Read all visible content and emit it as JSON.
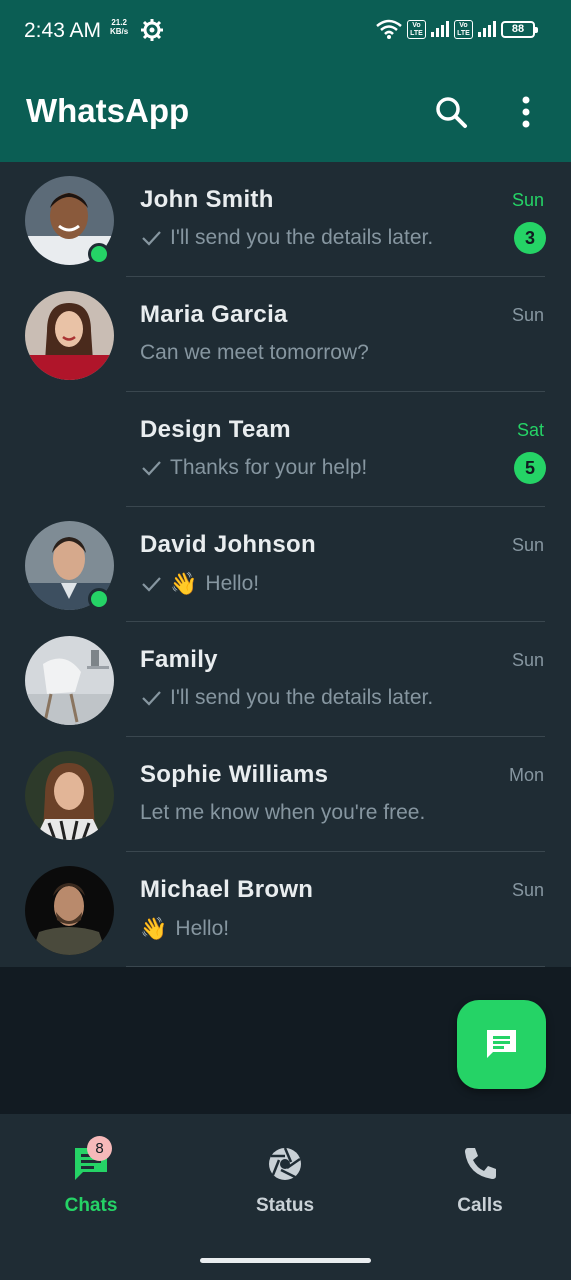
{
  "status_bar": {
    "time": "2:43 AM",
    "speed_value": "21.2",
    "speed_unit": "KB/s",
    "volte_1": "Vo LTE",
    "volte_2": "Vo LTE",
    "battery": "88"
  },
  "app_bar": {
    "title": "WhatsApp",
    "search_icon": "search-icon",
    "menu_icon": "more-vertical-icon"
  },
  "chats": [
    {
      "name": "John Smith",
      "message": "I'll send you the details later.",
      "time": "Sun",
      "unread": "3",
      "read_tick": true,
      "online": true
    },
    {
      "name": "Maria Garcia",
      "message": "Can we meet tomorrow?",
      "time": "Sun",
      "unread": "",
      "read_tick": false,
      "online": false
    },
    {
      "name": "Design Team",
      "message": "Thanks for your help!",
      "time": "Sat",
      "unread": "5",
      "read_tick": true,
      "online": false
    },
    {
      "name": "David Johnson",
      "message": "Hello!",
      "emoji": "👋",
      "time": "Sun",
      "unread": "",
      "read_tick": true,
      "online": true
    },
    {
      "name": "Family",
      "message": "I'll send you the details later.",
      "time": "Sun",
      "unread": "",
      "read_tick": true,
      "online": false
    },
    {
      "name": "Sophie Williams",
      "message": "Let me know when you're free.",
      "time": "Mon",
      "unread": "",
      "read_tick": false,
      "online": false
    },
    {
      "name": "Michael Brown",
      "message": "Hello!",
      "emoji": "👋",
      "time": "Sun",
      "unread": "",
      "read_tick": false,
      "online": false
    }
  ],
  "fab": {
    "icon": "new-chat-icon"
  },
  "bottom_nav": {
    "chats_label": "Chats",
    "chats_badge": "8",
    "status_label": "Status",
    "calls_label": "Calls"
  },
  "colors": {
    "header": "#0b5e54",
    "accent": "#25d366",
    "background": "#121b22",
    "row": "#1f2c34"
  }
}
